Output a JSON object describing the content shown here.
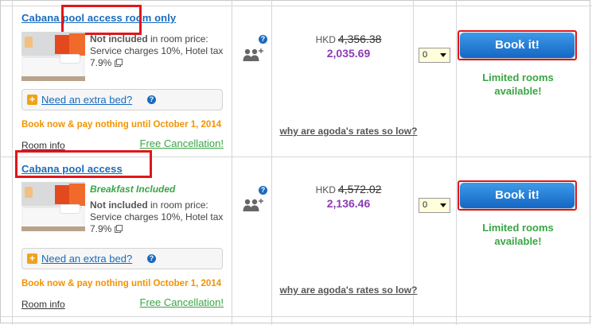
{
  "rooms": [
    {
      "title": "Cabana pool access room only",
      "meal": "",
      "not_included_label": "Not included",
      "not_included_text": "in room price: Service charges 10%, Hotel tax 7.9%",
      "extra_bed": "Need an extra bed?",
      "book_now_text": "Book now & pay nothing until October 1, 2014",
      "room_info": "Room info",
      "free_cancellation": "Free Cancellation!",
      "currency": "HKD",
      "original_price": "4,356.38",
      "discount_price": "2,035.69",
      "why_rates": "why are agoda's rates so low?",
      "quantity": "0",
      "book_button": "Book it!",
      "availability": "Limited rooms available!"
    },
    {
      "title": "Cabana pool access",
      "meal": "Breakfast Included",
      "not_included_label": "Not included",
      "not_included_text": "in room price: Service charges 10%, Hotel tax 7.9%",
      "extra_bed": "Need an extra bed?",
      "book_now_text": "Book now & pay nothing until October 1, 2014",
      "room_info": "Room info",
      "free_cancellation": "Free Cancellation!",
      "currency": "HKD",
      "original_price": "4,572.02",
      "discount_price": "2,136.46",
      "why_rates": "why are agoda's rates so low?",
      "quantity": "0",
      "book_button": "Book it!",
      "availability": "Limited rooms available!"
    }
  ],
  "icons": {
    "help": "help-icon",
    "guests": "guests-icon",
    "popup": "external-link-icon",
    "plus": "plus-icon"
  },
  "colors": {
    "link": "#1a6bbd",
    "green": "#3aa545",
    "orange": "#f39200",
    "purple_price": "#8d3ab5",
    "button": "#1f7fd6",
    "highlight": "#e0161b"
  }
}
